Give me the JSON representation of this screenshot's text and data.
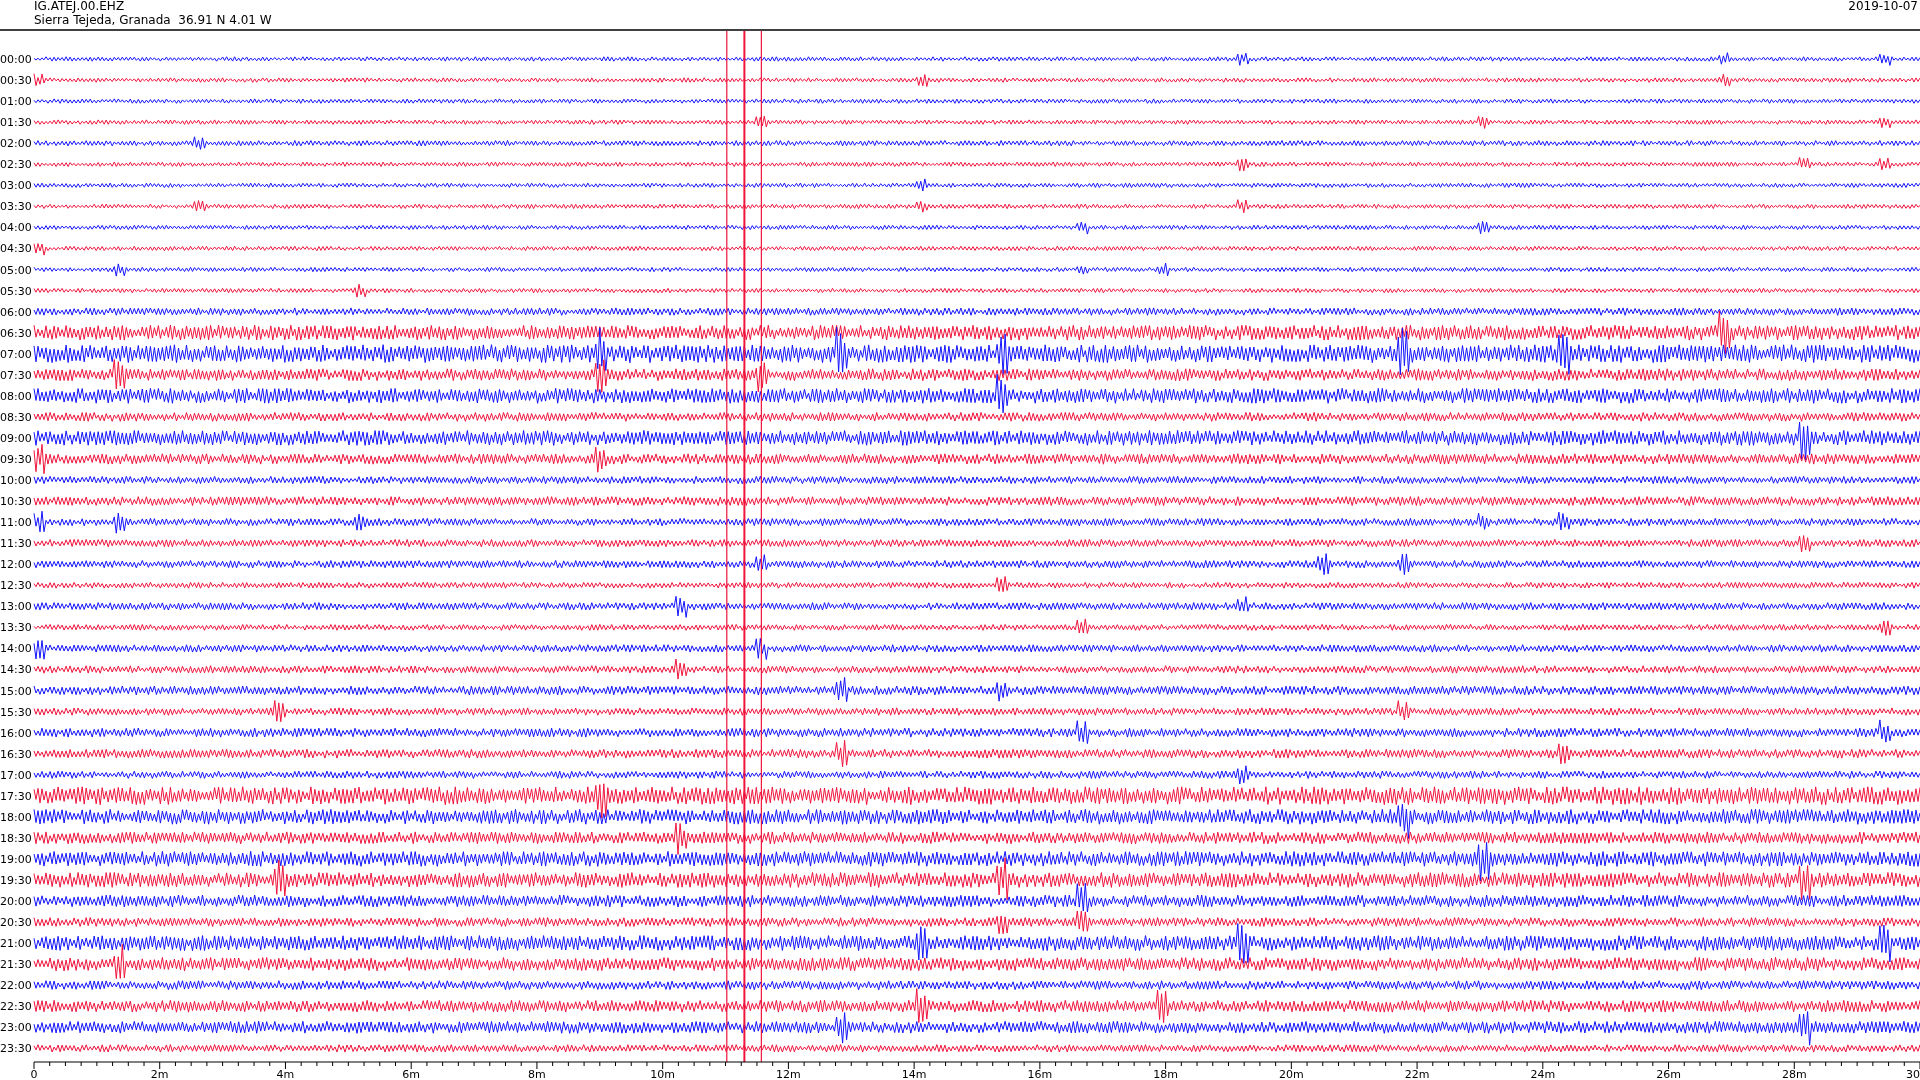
{
  "header": {
    "station": "IG.ATEJ.00.EHZ",
    "location": "Sierra Tejeda, Granada  36.91 N 4.01 W",
    "date": "2019-10-07"
  },
  "rows": [
    {
      "label": "00:00",
      "color": "#1414ff"
    },
    {
      "label": "00:30",
      "color": "#f0143c"
    },
    {
      "label": "01:00",
      "color": "#1414ff"
    },
    {
      "label": "01:30",
      "color": "#f0143c"
    },
    {
      "label": "02:00",
      "color": "#1414ff"
    },
    {
      "label": "02:30",
      "color": "#f0143c"
    },
    {
      "label": "03:00",
      "color": "#1414ff"
    },
    {
      "label": "03:30",
      "color": "#f0143c"
    },
    {
      "label": "04:00",
      "color": "#1414ff"
    },
    {
      "label": "04:30",
      "color": "#f0143c"
    },
    {
      "label": "05:00",
      "color": "#1414ff"
    },
    {
      "label": "05:30",
      "color": "#f0143c"
    },
    {
      "label": "06:00",
      "color": "#1414ff"
    },
    {
      "label": "06:30",
      "color": "#f0143c"
    },
    {
      "label": "07:00",
      "color": "#1414ff"
    },
    {
      "label": "07:30",
      "color": "#f0143c"
    },
    {
      "label": "08:00",
      "color": "#1414ff"
    },
    {
      "label": "08:30",
      "color": "#f0143c"
    },
    {
      "label": "09:00",
      "color": "#1414ff"
    },
    {
      "label": "09:30",
      "color": "#f0143c"
    },
    {
      "label": "10:00",
      "color": "#1414ff"
    },
    {
      "label": "10:30",
      "color": "#f0143c"
    },
    {
      "label": "11:00",
      "color": "#1414ff"
    },
    {
      "label": "11:30",
      "color": "#f0143c"
    },
    {
      "label": "12:00",
      "color": "#1414ff"
    },
    {
      "label": "12:30",
      "color": "#f0143c"
    },
    {
      "label": "13:00",
      "color": "#1414ff"
    },
    {
      "label": "13:30",
      "color": "#f0143c"
    },
    {
      "label": "14:00",
      "color": "#1414ff"
    },
    {
      "label": "14:30",
      "color": "#f0143c"
    },
    {
      "label": "15:00",
      "color": "#1414ff"
    },
    {
      "label": "15:30",
      "color": "#f0143c"
    },
    {
      "label": "16:00",
      "color": "#1414ff"
    },
    {
      "label": "16:30",
      "color": "#f0143c"
    },
    {
      "label": "17:00",
      "color": "#1414ff"
    },
    {
      "label": "17:30",
      "color": "#f0143c"
    },
    {
      "label": "18:00",
      "color": "#1414ff"
    },
    {
      "label": "18:30",
      "color": "#f0143c"
    },
    {
      "label": "19:00",
      "color": "#1414ff"
    },
    {
      "label": "19:30",
      "color": "#f0143c"
    },
    {
      "label": "20:00",
      "color": "#1414ff"
    },
    {
      "label": "20:30",
      "color": "#f0143c"
    },
    {
      "label": "21:00",
      "color": "#1414ff"
    },
    {
      "label": "21:30",
      "color": "#f0143c"
    },
    {
      "label": "22:00",
      "color": "#1414ff"
    },
    {
      "label": "22:30",
      "color": "#f0143c"
    },
    {
      "label": "23:00",
      "color": "#1414ff"
    },
    {
      "label": "23:30",
      "color": "#f0143c"
    }
  ],
  "x_axis": {
    "ticks": [
      "0",
      "2m",
      "4m",
      "6m",
      "8m",
      "10m",
      "12m",
      "14m",
      "16m",
      "18m",
      "20m",
      "22m",
      "24m",
      "26m",
      "28m",
      "30"
    ]
  }
}
